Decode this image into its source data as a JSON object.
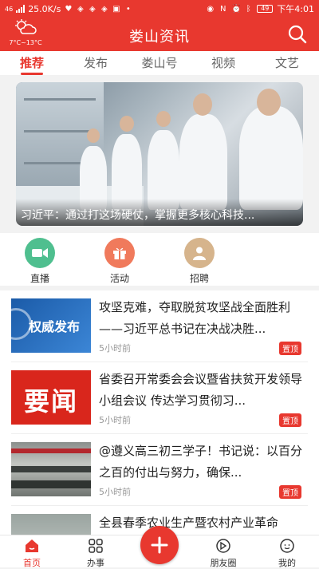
{
  "status_bar": {
    "network": "46",
    "speed": "25.0K/s",
    "battery": "49",
    "time": "下午4:01"
  },
  "header": {
    "title": "娄山资讯",
    "weather_temp": "7°C~13°C",
    "weather_icon": "cloudy-sun-icon",
    "search_icon": "search-icon"
  },
  "tabs": [
    {
      "label": "推荐",
      "active": true
    },
    {
      "label": "发布",
      "active": false
    },
    {
      "label": "娄山号",
      "active": false
    },
    {
      "label": "视频",
      "active": false
    },
    {
      "label": "文艺",
      "active": false
    }
  ],
  "banner": {
    "caption": "习近平：通过打这场硬仗，掌握更多核心科技..."
  },
  "quick_links": [
    {
      "label": "直播",
      "icon": "video-camera-icon",
      "color": "#4fbf8f"
    },
    {
      "label": "活动",
      "icon": "gift-icon",
      "color": "#f07a5c"
    },
    {
      "label": "招聘",
      "icon": "person-icon",
      "color": "#d6b48c"
    }
  ],
  "news": [
    {
      "title": "攻坚克难，夺取脱贫攻坚战全面胜利——习近平总书记在决战决胜...",
      "time": "5小时前",
      "badge": "置顶",
      "thumb_text": "权威发布"
    },
    {
      "title": "省委召开常委会会议暨省扶贫开发领导小组会议 传达学习贯彻习...",
      "time": "5小时前",
      "badge": "置顶",
      "thumb_text": "要闻"
    },
    {
      "title": "@遵义高三初三学子！书记说：以百分之百的付出与努力，确保...",
      "time": "5小时前",
      "badge": "置顶",
      "thumb_text": ""
    },
    {
      "title": "全县春季农业生产暨农村产业革命",
      "time": "",
      "badge": "",
      "thumb_text": ""
    }
  ],
  "bottom_nav": [
    {
      "label": "首页",
      "icon": "home-icon",
      "active": true
    },
    {
      "label": "办事",
      "icon": "grid-icon",
      "active": false
    },
    {
      "label": "",
      "icon": "plus-icon",
      "active": false
    },
    {
      "label": "朋友圈",
      "icon": "moments-icon",
      "active": false
    },
    {
      "label": "我的",
      "icon": "profile-icon",
      "active": false
    }
  ],
  "colors": {
    "brand": "#e8382f"
  }
}
